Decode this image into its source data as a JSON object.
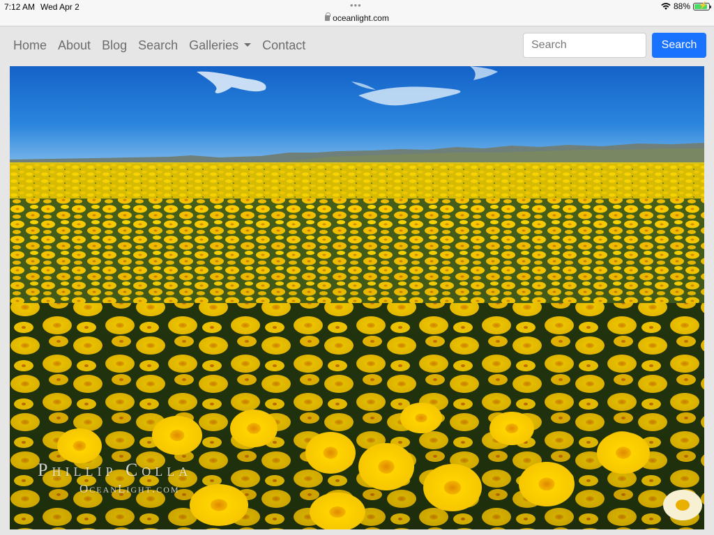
{
  "status_bar": {
    "time": "7:12 AM",
    "date": "Wed Apr 2",
    "url": "oceanlight.com",
    "battery": "88%",
    "battery_level": 0.88,
    "wifi_icon": "wifi-icon",
    "lock_icon": "lock-icon"
  },
  "nav": {
    "items": [
      {
        "label": "Home"
      },
      {
        "label": "About"
      },
      {
        "label": "Blog"
      },
      {
        "label": "Search"
      },
      {
        "label": "Galleries"
      },
      {
        "label": "Contact"
      }
    ],
    "search_placeholder": "Search",
    "search_button": "Search",
    "accent_color": "#1a73ff"
  },
  "photo": {
    "watermark_line1": "Phillip Colla",
    "watermark_line2": "OceanLight.com"
  }
}
